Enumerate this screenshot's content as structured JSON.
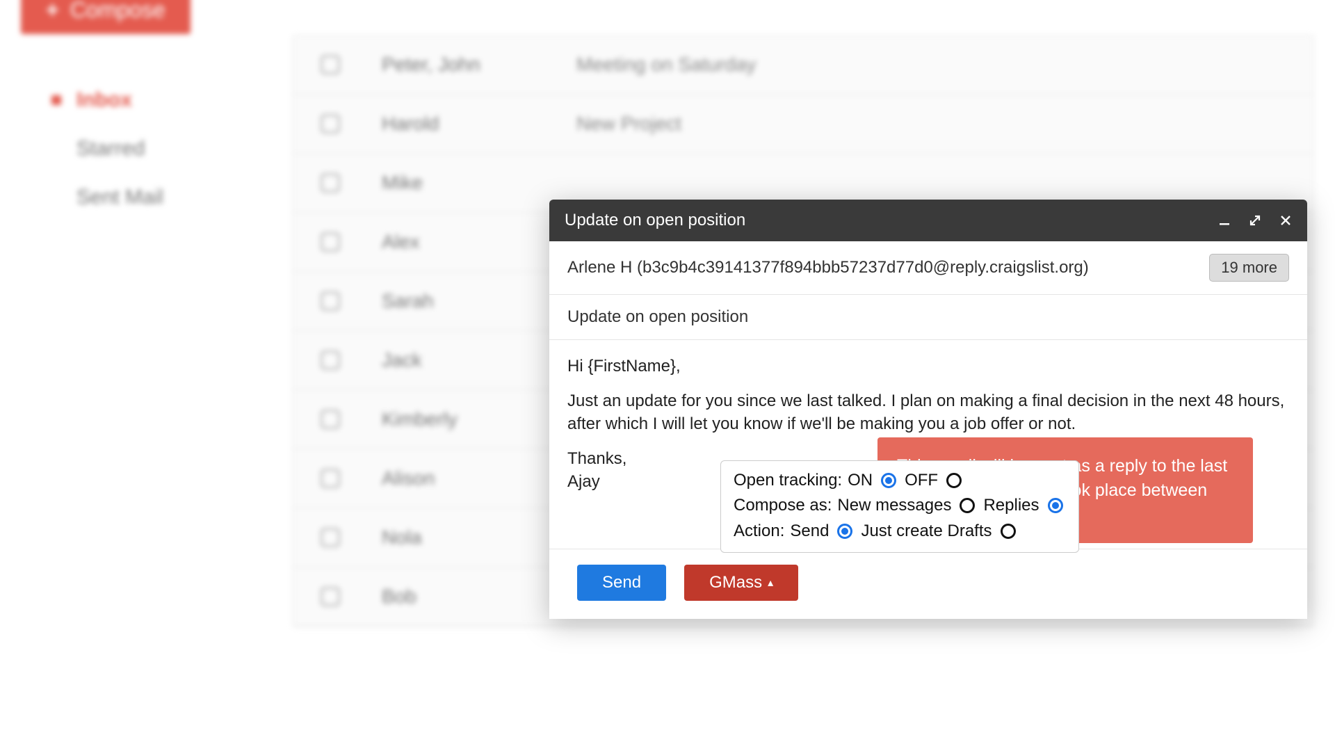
{
  "sidebar": {
    "compose_label": "Compose",
    "items": [
      {
        "label": "Inbox",
        "active": true
      },
      {
        "label": "Starred",
        "active": false
      },
      {
        "label": "Sent Mail",
        "active": false
      }
    ]
  },
  "mail_list": [
    {
      "sender": "Peter, John",
      "subject": "Meeting on Saturday"
    },
    {
      "sender": "Harold",
      "subject": "New Project"
    },
    {
      "sender": "Mike",
      "subject": ""
    },
    {
      "sender": "Alex",
      "subject": ""
    },
    {
      "sender": "Sarah",
      "subject": ""
    },
    {
      "sender": "Jack",
      "subject": ""
    },
    {
      "sender": "Kimberly",
      "subject": ""
    },
    {
      "sender": "Alison",
      "subject": ""
    },
    {
      "sender": "Nola",
      "subject": ""
    },
    {
      "sender": "Bob",
      "subject": ""
    }
  ],
  "compose": {
    "header_title": "Update on open position",
    "recipient": "Arlene H (b3c9b4c39141377f894bbb57237d77d0@reply.craigslist.org)",
    "more_chip": "19 more",
    "subject": "Update on open position",
    "body_greeting": "Hi {FirstName},",
    "body_para": "Just an update for you since we last talked. I plan on making a final decision in the next 48 hours, after which I will let you know if we'll be making you a job offer or not.",
    "body_thanks": "Thanks,",
    "body_signature": "Ajay",
    "callout": "This email will be sent as a reply to the last email exchange that took place between me and the recipient.",
    "options": {
      "open_tracking_label": "Open tracking:",
      "on_label": "ON",
      "off_label": "OFF",
      "open_tracking_selected": "ON",
      "compose_as_label": "Compose as:",
      "new_messages_label": "New messages",
      "replies_label": "Replies",
      "compose_as_selected": "Replies",
      "action_label": "Action:",
      "send_label": "Send",
      "drafts_label": "Just create Drafts",
      "action_selected": "Send"
    },
    "send_button": "Send",
    "gmass_button": "GMass",
    "gmass_caret": "▴"
  }
}
